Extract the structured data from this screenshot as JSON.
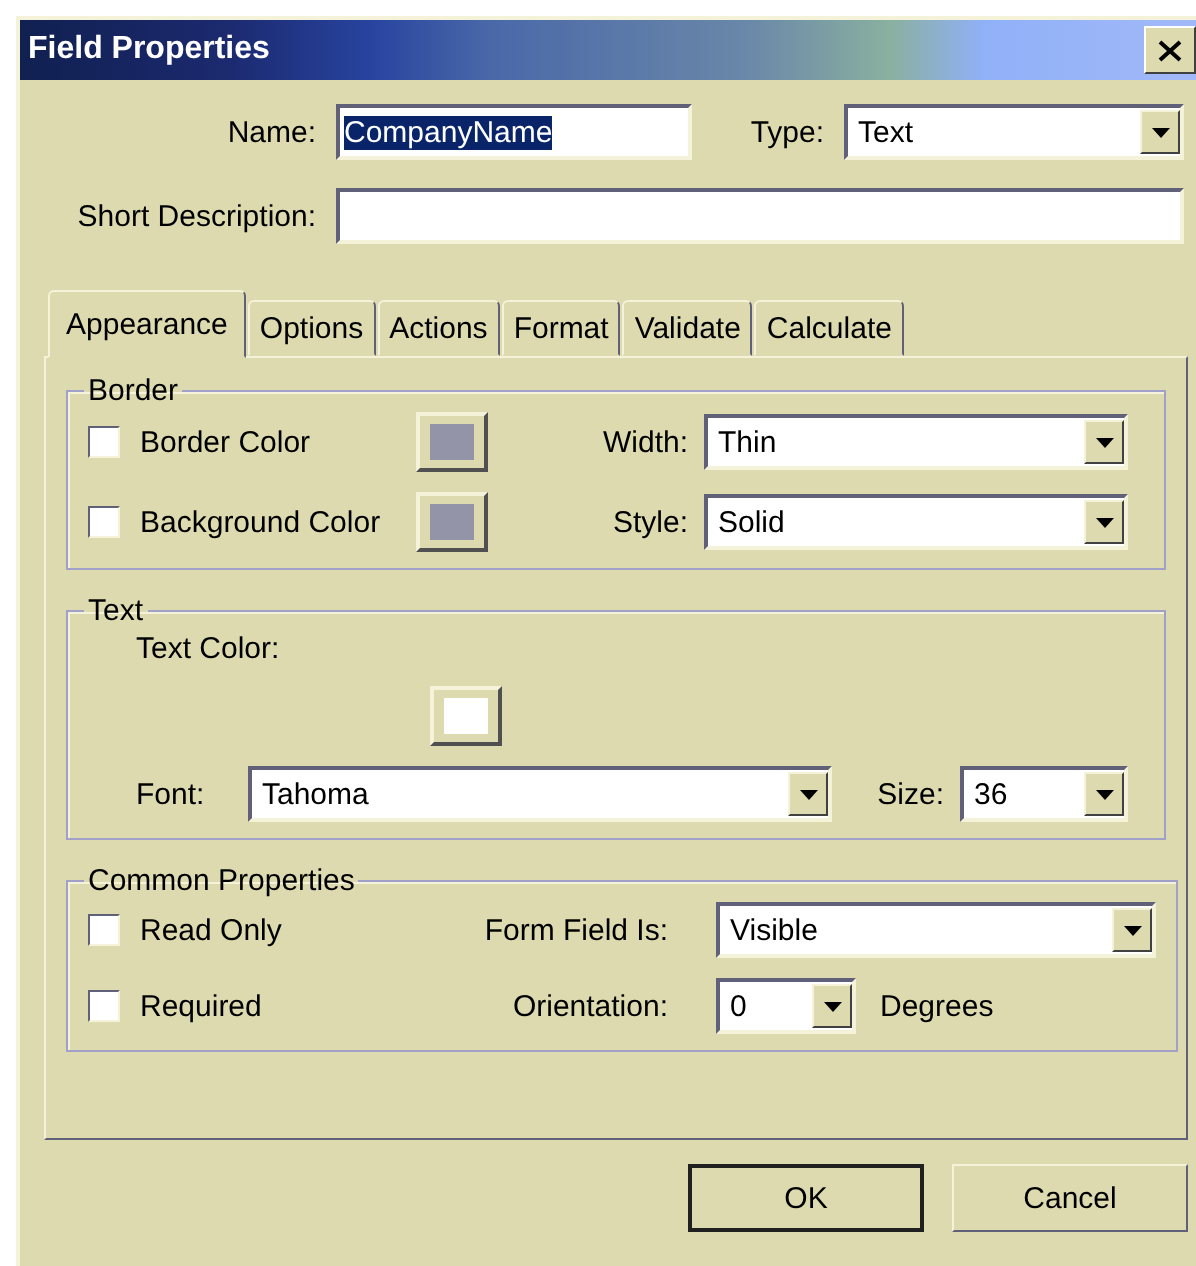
{
  "window": {
    "title": "Field Properties"
  },
  "name": {
    "label": "Name:",
    "value": "CompanyName",
    "selected": true
  },
  "type": {
    "label": "Type:",
    "value": "Text"
  },
  "short_description": {
    "label": "Short Description:"
  },
  "tabs": [
    {
      "label": "Appearance",
      "selected": true
    },
    {
      "label": "Options",
      "selected": false
    },
    {
      "label": "Actions",
      "selected": false
    },
    {
      "label": "Format",
      "selected": false
    },
    {
      "label": "Validate",
      "selected": false
    },
    {
      "label": "Calculate",
      "selected": false
    }
  ],
  "border": {
    "title": "Border",
    "border_color": {
      "label": "Border Color",
      "checked": false,
      "color": "#9494a8"
    },
    "background_color": {
      "label": "Background Color",
      "checked": false,
      "color": "#9494a8"
    },
    "width": {
      "label": "Width:",
      "value": "Thin"
    },
    "style": {
      "label": "Style:",
      "value": "Solid"
    }
  },
  "text": {
    "title": "Text",
    "text_color": {
      "label": "Text Color:",
      "color": "#ffffff"
    },
    "font": {
      "label": "Font:",
      "value": "Tahoma"
    },
    "size": {
      "label": "Size:",
      "value": "36"
    }
  },
  "common": {
    "title": "Common Properties",
    "read_only": {
      "label": "Read Only",
      "checked": false
    },
    "required": {
      "label": "Required",
      "checked": false
    },
    "form_field_is": {
      "label": "Form Field Is:",
      "value": "Visible"
    },
    "orientation": {
      "label": "Orientation:",
      "value": "0",
      "unit": "Degrees"
    }
  },
  "buttons": [
    {
      "label": "OK",
      "default": true
    },
    {
      "label": "Cancel",
      "default": false
    }
  ]
}
